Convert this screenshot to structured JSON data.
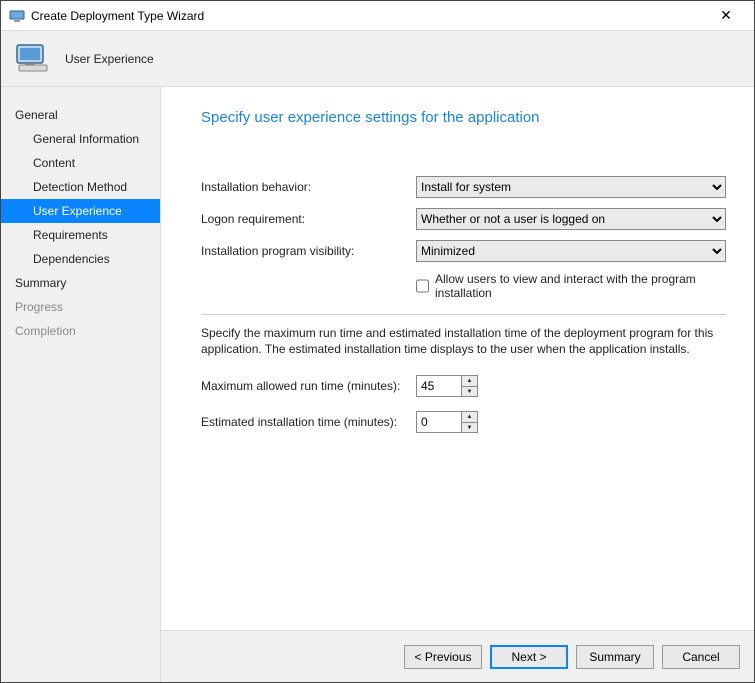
{
  "window": {
    "title": "Create Deployment Type Wizard",
    "close_glyph": "✕"
  },
  "header": {
    "subtitle": "User Experience"
  },
  "sidebar": {
    "groups": [
      {
        "label": "General",
        "enabled": true,
        "children": [
          {
            "label": "General Information",
            "selected": false
          },
          {
            "label": "Content",
            "selected": false
          },
          {
            "label": "Detection Method",
            "selected": false
          },
          {
            "label": "User Experience",
            "selected": true
          },
          {
            "label": "Requirements",
            "selected": false
          },
          {
            "label": "Dependencies",
            "selected": false
          }
        ]
      },
      {
        "label": "Summary",
        "enabled": true,
        "children": []
      },
      {
        "label": "Progress",
        "enabled": false,
        "children": []
      },
      {
        "label": "Completion",
        "enabled": false,
        "children": []
      }
    ]
  },
  "main": {
    "title": "Specify user experience settings for the application",
    "fields": {
      "install_behavior_label": "Installation behavior:",
      "install_behavior_value": "Install for system",
      "logon_req_label": "Logon requirement:",
      "logon_req_value": "Whether or not a user is logged on",
      "visibility_label": "Installation program visibility:",
      "visibility_value": "Minimized",
      "allow_interaction_label": "Allow users to view and interact with the program installation",
      "allow_interaction_checked": false,
      "desc": "Specify the maximum run time and estimated installation time of the deployment program for this application. The estimated installation time displays to the user when the application installs.",
      "max_runtime_label": "Maximum allowed run time (minutes):",
      "max_runtime_value": "45",
      "est_time_label": "Estimated installation time (minutes):",
      "est_time_value": "0"
    }
  },
  "footer": {
    "previous": "< Previous",
    "next": "Next >",
    "summary": "Summary",
    "cancel": "Cancel"
  }
}
